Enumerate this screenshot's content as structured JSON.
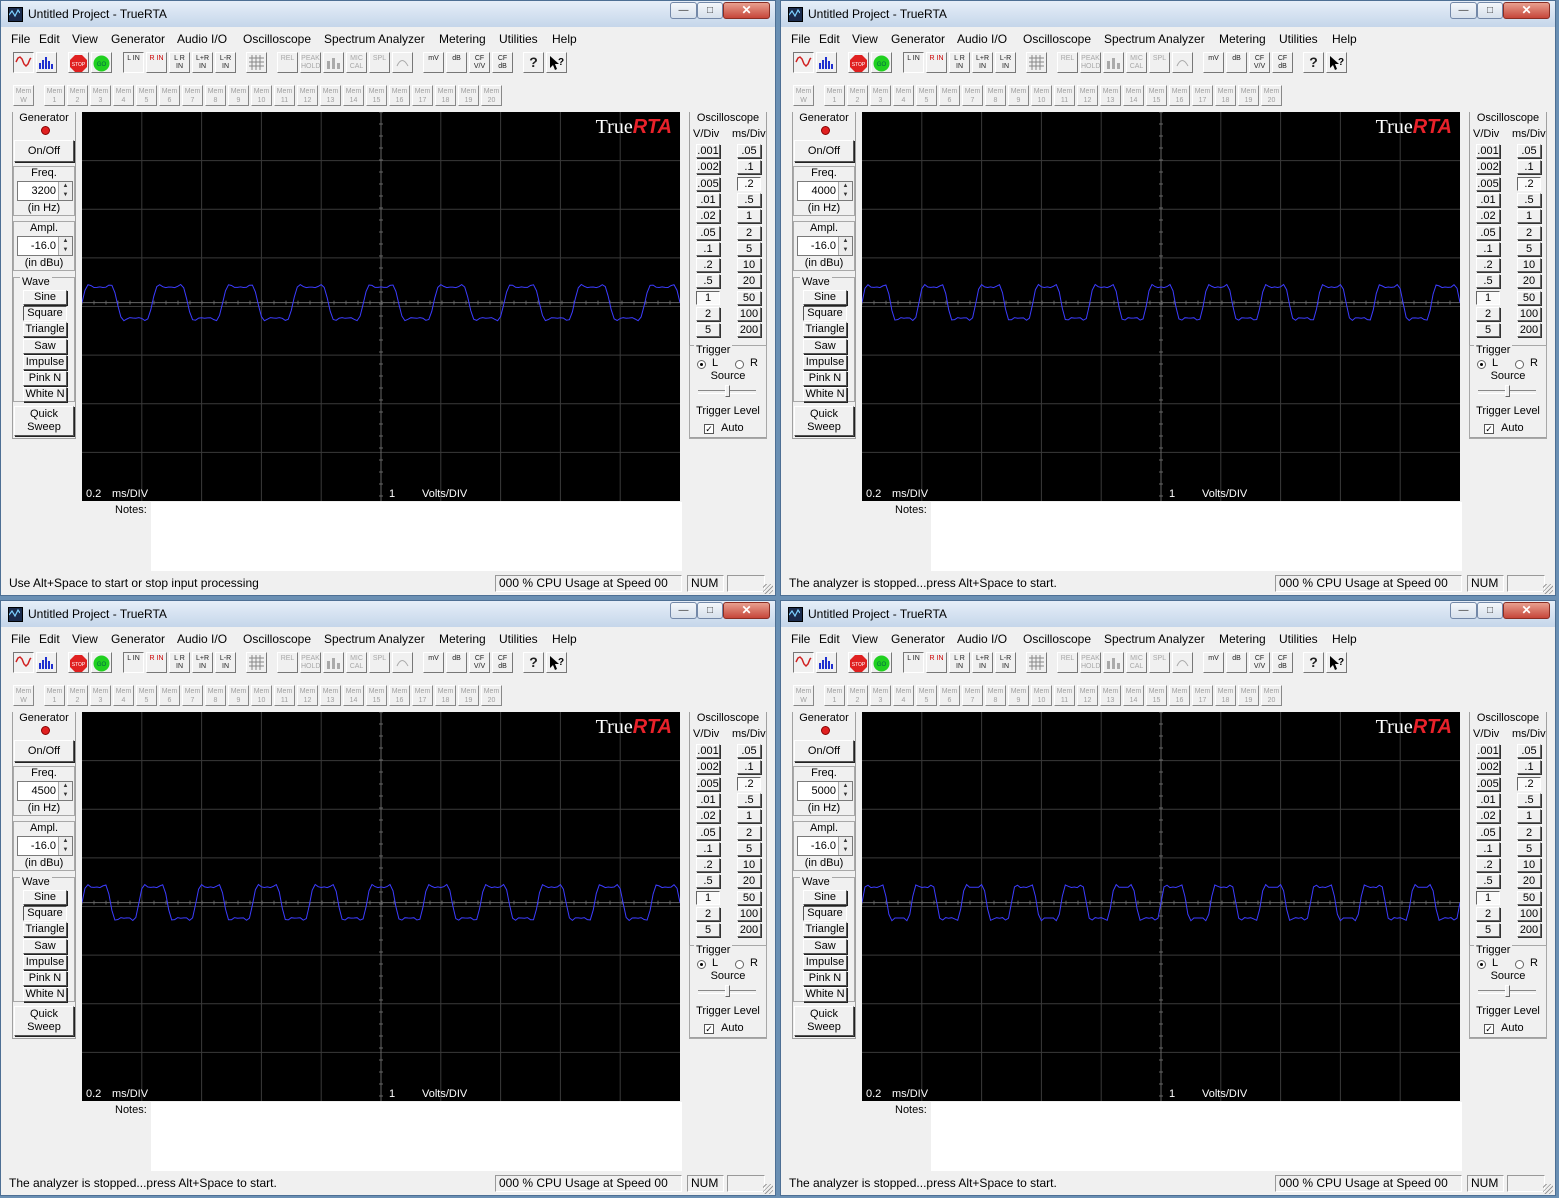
{
  "app_title": "Untitled Project - TrueRTA",
  "menu": [
    "File",
    "Edit",
    "View",
    "Generator",
    "Audio I/O",
    "Oscilloscope",
    "Spectrum Analyzer",
    "Metering",
    "Utilities",
    "Help"
  ],
  "toolbar": [
    "",
    "",
    "STOP",
    "GO",
    "L IN",
    "R IN",
    "L R IN",
    "L+R IN",
    "L-R IN",
    "",
    "REL",
    "PEAK HOLD",
    "",
    "MIC CAL",
    "SPL",
    "",
    "mV",
    "dB",
    "CF V/V",
    "CF dB",
    "?",
    ""
  ],
  "mem_buttons": [
    "Mem W",
    "Mem 1",
    "Mem 2",
    "Mem 3",
    "Mem 4",
    "Mem 5",
    "Mem 6",
    "Mem 7",
    "Mem 8",
    "Mem 9",
    "Mem 10",
    "Mem 11",
    "Mem 12",
    "Mem 13",
    "Mem 14",
    "Mem 15",
    "Mem 16",
    "Mem 17",
    "Mem 18",
    "Mem 19",
    "Mem 20"
  ],
  "generator": {
    "title": "Generator",
    "onoff": "On/Off",
    "freq_label": "Freq.",
    "freq_unit": "(in Hz)",
    "ampl_label": "Ampl.",
    "ampl_unit": "(in dBu)",
    "wave_label": "Wave",
    "waves": [
      "Sine",
      "Square",
      "Triangle",
      "Saw",
      "Impulse",
      "Pink N",
      "White N"
    ],
    "selected_wave": "Square",
    "quick_sweep": [
      "Quick",
      "Sweep"
    ]
  },
  "oscilloscope": {
    "title": "Oscilloscope",
    "vdiv_header": "V/Div",
    "msdiv_header": "ms/Div",
    "vdiv": [
      ".001",
      ".002",
      ".005",
      ".01",
      ".02",
      ".05",
      ".1",
      ".2",
      ".5",
      "1",
      "2",
      "5"
    ],
    "msdiv": [
      ".05",
      ".1",
      ".2",
      ".5",
      "1",
      "2",
      "5",
      "10",
      "20",
      "50",
      "100",
      "200"
    ],
    "vdiv_selected": "1",
    "msdiv_selected": ".2",
    "trigger_label": "Trigger",
    "trigger_L": "L",
    "trigger_R": "R",
    "source_label": "Source",
    "trigger_level_label": "Trigger Level",
    "auto_label": "Auto",
    "auto_checked": true,
    "trigger_source": "L"
  },
  "scope_labels": {
    "ms_value": "0.2",
    "ms_unit": "ms/DIV",
    "v_value": "1",
    "v_unit": "Volts/DIV"
  },
  "logo": {
    "true": "True",
    "rta": "RTA"
  },
  "notes_label": "Notes:",
  "status_cpu": "000 % CPU Usage at Speed 00",
  "status_num": "NUM",
  "colors": {
    "trace": "#3c3cff",
    "grid": "#3a3a3a",
    "scope_bg": "#000000",
    "logo_red": "#e8222a"
  },
  "windows": [
    {
      "freq": "3200",
      "ampl": "-16.0",
      "status": "Use Alt+Space to start or stop input processing",
      "cycles": 8.5,
      "phase": 0.0
    },
    {
      "freq": "4000",
      "ampl": "-16.0",
      "status": "The analyzer is stopped...press Alt+Space to start.",
      "cycles": 10.5,
      "phase": 0.0
    },
    {
      "freq": "4500",
      "ampl": "-16.0",
      "status": "The analyzer is stopped...press Alt+Space to start.",
      "cycles": 10.5,
      "phase": 0.0
    },
    {
      "freq": "5000",
      "ampl": "-16.0",
      "status": "The analyzer is stopped...press Alt+Space to start.",
      "cycles": 12.0,
      "phase": 0.0
    }
  ]
}
